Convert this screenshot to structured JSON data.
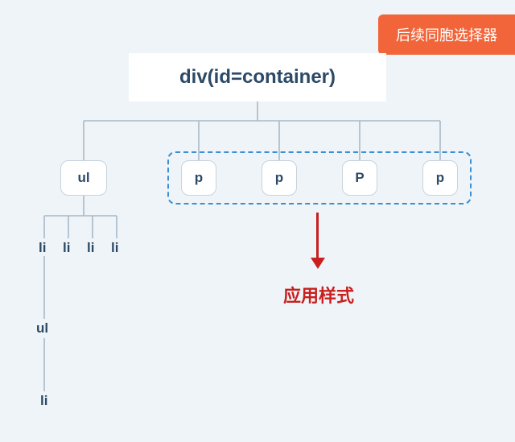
{
  "badge": "后续同胞选择器",
  "root": "div(id=container)",
  "nodes": {
    "ul": "ul",
    "p1": "p",
    "p2": "p",
    "p3": "P",
    "p4": "p",
    "li1": "li",
    "li2": "li",
    "li3": "li",
    "li4": "li",
    "ul2": "ul",
    "li5": "li"
  },
  "apply_label": "应用样式"
}
